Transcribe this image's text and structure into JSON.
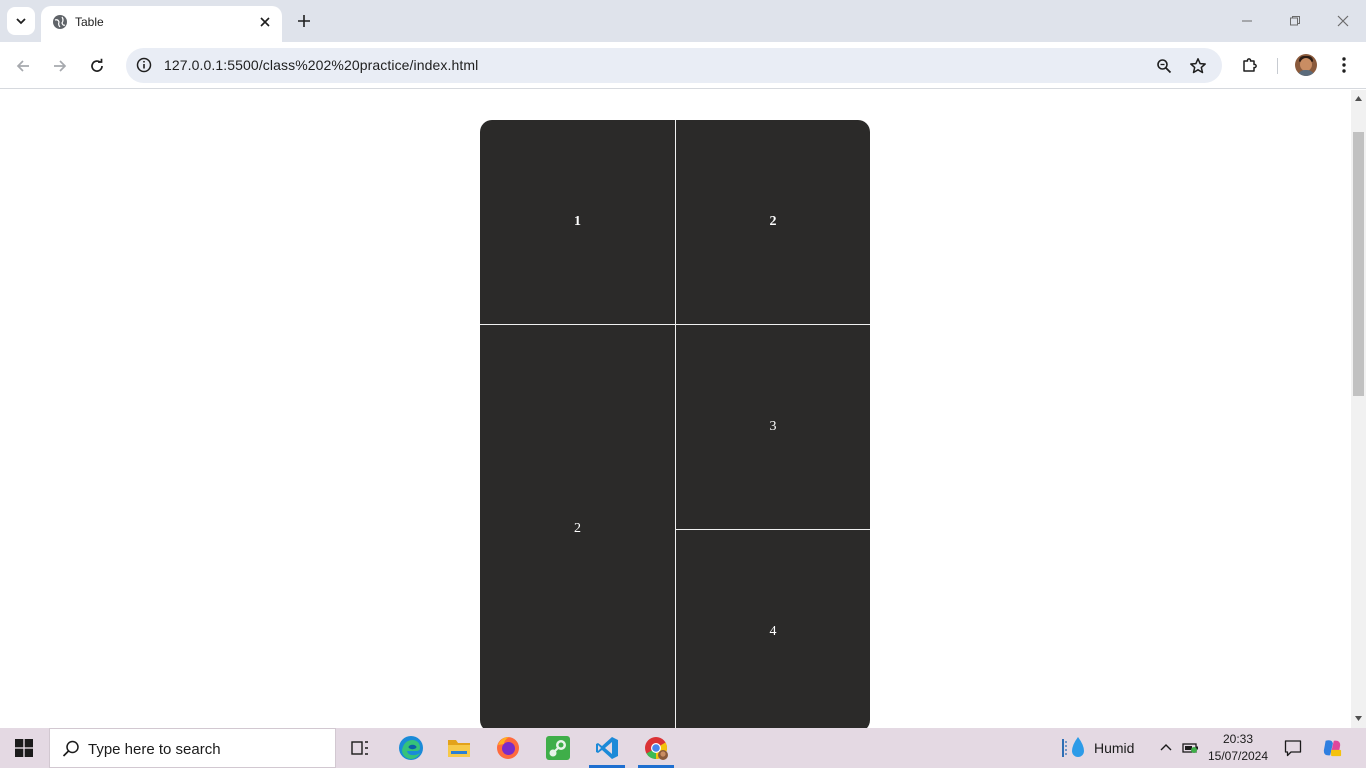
{
  "browser": {
    "tab": {
      "title": "Tab​le",
      "favicon": "globe-icon"
    },
    "address": {
      "url": "127.0.0.1:5500/class%202%20practice/index.html"
    }
  },
  "table": {
    "header": [
      "1",
      "2"
    ],
    "rows": [
      {
        "left": "2",
        "right": "3"
      },
      {
        "right": "4"
      }
    ]
  },
  "taskbar": {
    "search_placeholder": "Type here to search",
    "weather": "Humid",
    "time": "20:33",
    "date": "15/07/2024",
    "apps": [
      "task-view-icon",
      "edge-icon",
      "file-explorer-icon",
      "firefox-icon",
      "steam-icon",
      "vscode-icon",
      "chrome-icon"
    ]
  },
  "colors": {
    "table_bg": "#2b2a29",
    "tabstrip_bg": "#dfe3eb",
    "taskbar_bg": "#e4d9e3",
    "omnibox_bg": "#e9edf5"
  }
}
